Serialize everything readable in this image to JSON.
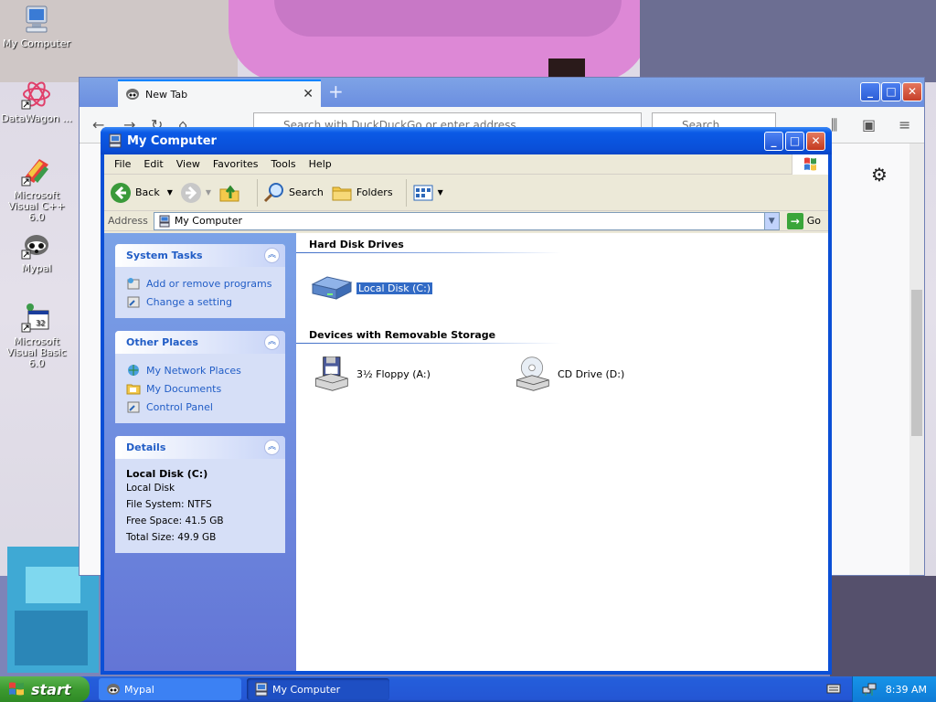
{
  "desktop": {
    "icons": [
      {
        "label": "My Computer",
        "icon": "my-computer-icon"
      },
      {
        "label": "DataWagon ...",
        "icon": "datawagon-icon"
      },
      {
        "label": "Microsoft Visual C++ 6.0",
        "icon": "visual-cpp-icon"
      },
      {
        "label": "Mypal",
        "icon": "mypal-icon"
      },
      {
        "label": "Microsoft Visual Basic 6.0",
        "icon": "visual-basic-icon"
      }
    ]
  },
  "browser": {
    "tab_title": "New Tab",
    "url_placeholder": "Search with DuckDuckGo or enter address",
    "search_placeholder": "Search"
  },
  "explorer": {
    "title": "My Computer",
    "menu": [
      "File",
      "Edit",
      "View",
      "Favorites",
      "Tools",
      "Help"
    ],
    "toolbar": {
      "back": "Back",
      "search": "Search",
      "folders": "Folders"
    },
    "address": {
      "label": "Address",
      "value": "My Computer",
      "go": "Go"
    },
    "system_tasks": {
      "title": "System Tasks",
      "items": [
        "Add or remove programs",
        "Change a setting"
      ]
    },
    "other_places": {
      "title": "Other Places",
      "items": [
        "My Network Places",
        "My Documents",
        "Control Panel"
      ]
    },
    "details": {
      "title": "Details",
      "name": "Local Disk (C:)",
      "type": "Local Disk",
      "file_system": "File System: NTFS",
      "free_space": "Free Space: 41.5 GB",
      "total_size": "Total Size: 49.9 GB"
    },
    "groups": {
      "hard_disks": {
        "title": "Hard Disk Drives",
        "items": [
          "Local Disk (C:)"
        ]
      },
      "removable": {
        "title": "Devices with Removable Storage",
        "items": [
          "3½ Floppy (A:)",
          "CD Drive (D:)"
        ]
      }
    }
  },
  "taskbar": {
    "start": "start",
    "tasks": [
      "Mypal",
      "My Computer"
    ],
    "clock": "8:39 AM"
  },
  "colors": {
    "xp_blue": "#0b4fd6",
    "task_link": "#215dc6",
    "start_green": "#3c9a30"
  }
}
